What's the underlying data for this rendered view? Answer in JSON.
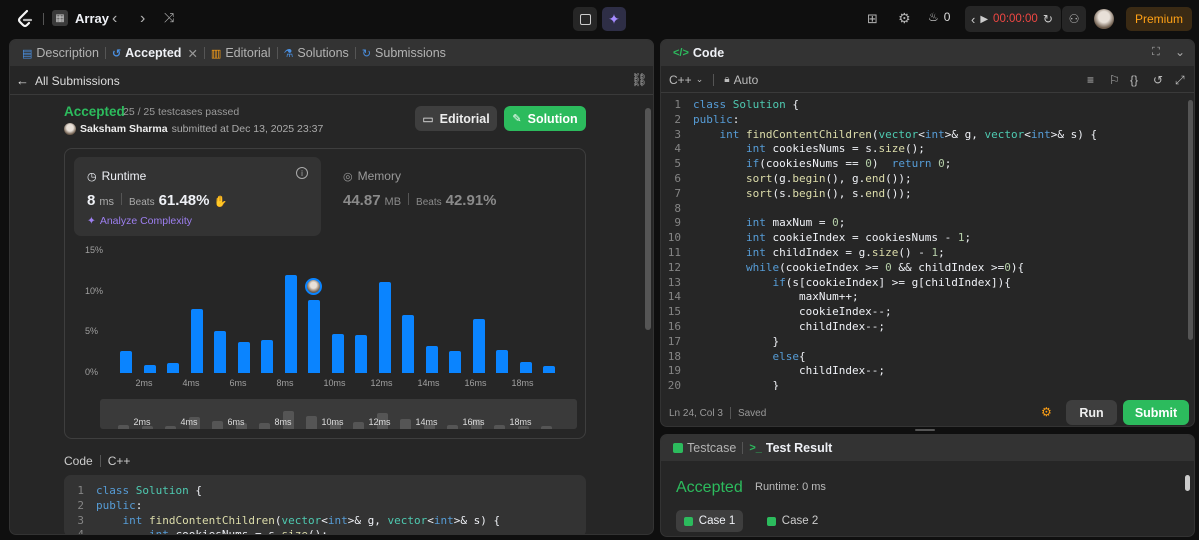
{
  "topbar": {
    "problem_list_label": "Array",
    "timer": "00:00:00",
    "streak_count": "0",
    "premium_label": "Premium"
  },
  "left_tabs": [
    {
      "label": "Description"
    },
    {
      "label": "Accepted"
    },
    {
      "label": "Editorial"
    },
    {
      "label": "Solutions"
    },
    {
      "label": "Submissions"
    }
  ],
  "submission": {
    "back_label": "All Submissions",
    "status": "Accepted",
    "testcases": "25 / 25 testcases passed",
    "user": "Saksham Sharma",
    "submitted_text": "submitted at Dec 13, 2025 23:37",
    "editorial_button": "Editorial",
    "solution_button": "Solution"
  },
  "runtime": {
    "label": "Runtime",
    "value": "8",
    "unit": "ms",
    "beats_label": "Beats",
    "beats_value": "61.48%",
    "analyze_label": "Analyze Complexity"
  },
  "memory": {
    "label": "Memory",
    "value": "44.87",
    "unit": "MB",
    "beats_label": "Beats",
    "beats_value": "42.91%"
  },
  "chart_data": {
    "type": "bar",
    "y_ticks": [
      "15%",
      "10%",
      "5%",
      "0%"
    ],
    "ylim": [
      0,
      15
    ],
    "x_ticks": [
      "2ms",
      "4ms",
      "6ms",
      "8ms",
      "10ms",
      "12ms",
      "14ms",
      "16ms",
      "18ms"
    ],
    "values": [
      2.7,
      1.0,
      1.2,
      7.9,
      5.2,
      3.8,
      4.1,
      12.0,
      9.0,
      4.8,
      4.7,
      11.2,
      7.1,
      3.3,
      2.7,
      6.7,
      2.8,
      1.3,
      0.8
    ],
    "highlight_index": 8,
    "mini_x_ticks": [
      "2ms",
      "4ms",
      "6ms",
      "8ms",
      "10ms",
      "12ms",
      "14ms",
      "16ms",
      "18ms"
    ]
  },
  "code_section": {
    "label": "Code",
    "language": "C++"
  },
  "preview_lines": [
    "class Solution {",
    "public:",
    "    int findContentChildren(vector<int>& g, vector<int>& s) {",
    "        int cookiesNums = s.size();"
  ],
  "code_panel": {
    "title": "Code",
    "language": "C++",
    "mode": "Auto",
    "status_position": "Ln 24, Col 3",
    "saved_label": "Saved",
    "run_label": "Run",
    "submit_label": "Submit"
  },
  "code_lines": [
    "class Solution {",
    "public:",
    "    int findContentChildren(vector<int>& g, vector<int>& s) {",
    "        int cookiesNums = s.size();",
    "        if(cookiesNums == 0)  return 0;",
    "        sort(g.begin(), g.end());",
    "        sort(s.begin(), s.end());",
    "",
    "        int maxNum = 0;",
    "        int cookieIndex = cookiesNums - 1;",
    "        int childIndex = g.size() - 1;",
    "        while(cookieIndex >= 0 && childIndex >=0){",
    "            if(s[cookieIndex] >= g[childIndex]){",
    "                maxNum++;",
    "                cookieIndex--;",
    "                childIndex--;",
    "            }",
    "            else{",
    "                childIndex--;",
    "            }"
  ],
  "test_panel": {
    "tab_testcase": "Testcase",
    "tab_result": "Test Result",
    "status": "Accepted",
    "runtime_text": "Runtime: 0 ms",
    "cases": [
      "Case 1",
      "Case 2"
    ]
  },
  "colors": {
    "accent_green": "#2cbb5d",
    "bar_blue": "#0a84ff",
    "premium": "#ffa116"
  }
}
